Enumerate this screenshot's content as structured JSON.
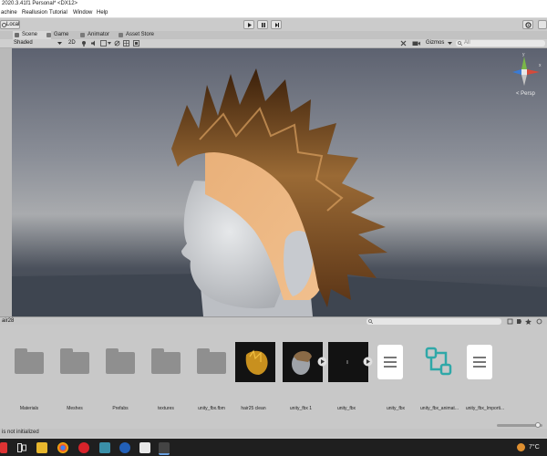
{
  "window": {
    "title": "2020.3.41f1 Personal* <DX12>"
  },
  "menu": [
    "achine",
    "Reallusion",
    "Tutorial",
    "Window",
    "Help"
  ],
  "toolbar": {
    "pivot_label": "Local"
  },
  "tabs": [
    {
      "label": "Scene",
      "active": true,
      "icon": "scene-icon"
    },
    {
      "label": "Game",
      "active": false,
      "icon": "game-icon"
    },
    {
      "label": "Animator",
      "active": false,
      "icon": "animator-icon"
    },
    {
      "label": "Asset Store",
      "active": false,
      "icon": "store-icon"
    }
  ],
  "scene_toolbar": {
    "shading_mode": "Shaded",
    "mode_2d": "2D",
    "gizmos_label": "Gizmos",
    "search_placeholder": "All"
  },
  "gizmo": {
    "projection_label": "< Persp",
    "axis_y": "y",
    "axis_x": "x"
  },
  "project": {
    "breadcrumb": "air28",
    "assets": [
      {
        "label": "Materials",
        "kind": "folder"
      },
      {
        "label": "Meshes",
        "kind": "folder"
      },
      {
        "label": "Prefabs",
        "kind": "folder"
      },
      {
        "label": "textures",
        "kind": "folder"
      },
      {
        "label": "unity_fbx.fbm",
        "kind": "folder"
      },
      {
        "label": "hair25 clean",
        "kind": "material"
      },
      {
        "label": "unity_fbx 1",
        "kind": "model"
      },
      {
        "label": "unity_fbx",
        "kind": "model"
      },
      {
        "label": "unity_fbx",
        "kind": "text"
      },
      {
        "label": "unity_fbx_animat...",
        "kind": "animator"
      },
      {
        "label": "unity_fbx_Importi...",
        "kind": "text"
      }
    ]
  },
  "status": {
    "message": "is not initialized"
  },
  "taskbar": {
    "weather": "7°C"
  },
  "colors": {
    "accent_blue": "#3a7bd5",
    "hair_dark": "#4a2a10",
    "hair_light": "#d8a060",
    "skin": "#d0d2d5"
  }
}
